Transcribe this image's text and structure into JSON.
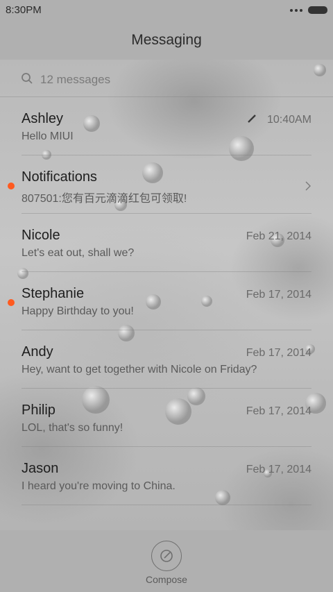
{
  "status_bar": {
    "time": "8:30PM"
  },
  "header": {
    "title": "Messaging"
  },
  "search": {
    "placeholder": "12 messages"
  },
  "messages": [
    {
      "name": "Ashley",
      "preview": "Hello MIUI",
      "time": "10:40AM",
      "unread": false,
      "draft": true,
      "chevron": false
    },
    {
      "name": "Notifications",
      "preview": "807501:您有百元滴滴红包可领取!",
      "time": "",
      "unread": true,
      "draft": false,
      "chevron": true
    },
    {
      "name": "Nicole",
      "preview": "Let's eat out, shall we?",
      "time": "Feb 21, 2014",
      "unread": false,
      "draft": false,
      "chevron": false
    },
    {
      "name": "Stephanie",
      "preview": "Happy Birthday to you!",
      "time": "Feb 17, 2014",
      "unread": true,
      "draft": false,
      "chevron": false
    },
    {
      "name": "Andy",
      "preview": "Hey, want to get together with Nicole on Friday?",
      "time": "Feb 17, 2014",
      "unread": false,
      "draft": false,
      "chevron": false
    },
    {
      "name": "Philip",
      "preview": "LOL, that's so funny!",
      "time": "Feb 17, 2014",
      "unread": false,
      "draft": false,
      "chevron": false
    },
    {
      "name": "Jason",
      "preview": "I heard you're moving to China.",
      "time": "Feb 17, 2014",
      "unread": false,
      "draft": false,
      "chevron": false
    }
  ],
  "bottom_bar": {
    "compose_label": "Compose"
  },
  "colors": {
    "unread_dot": "#ff5a1f",
    "bar_bg": "#b0b0b0"
  }
}
